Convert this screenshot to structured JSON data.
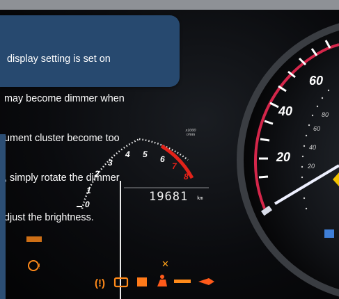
{
  "callout": {
    "text_lines": [
      " display setting is set on",
      "may become dimmer when",
      "ument cluster become too",
      ", simply rotate the dimmer",
      "djust the brightness."
    ]
  },
  "tachometer": {
    "labels": [
      "0",
      "1",
      "2",
      "3",
      "4",
      "5",
      "6",
      "7",
      "8"
    ],
    "unit_top": "x1000",
    "unit_bottom": "r/min",
    "redline_color": "#e2231a"
  },
  "odometer": {
    "reading": "19681",
    "unit": "km"
  },
  "speedometer": {
    "outer_labels": [
      "20",
      "40",
      "60"
    ],
    "inner_labels": [
      "20",
      "40",
      "60",
      "80"
    ],
    "ring_color": "#d4264a",
    "needle_color": "#e8e8ff"
  },
  "warning_lights": [
    {
      "icon": "tpms-icon",
      "color": "#ff8a1a"
    },
    {
      "icon": "check-engine-icon",
      "color": "#ff8a1a"
    },
    {
      "icon": "abs-icon",
      "color": "#ff8a1a"
    },
    {
      "icon": "seatbelt-icon",
      "color": "#ff5a1a"
    },
    {
      "icon": "key-icon",
      "color": "#ff8a1a"
    },
    {
      "icon": "oil-pressure-icon",
      "color": "#ff5a1a"
    },
    {
      "icon": "traction-icon",
      "color": "#ffa21a"
    },
    {
      "icon": "parking-brake-icon",
      "color": "#ff8a1a"
    }
  ]
}
